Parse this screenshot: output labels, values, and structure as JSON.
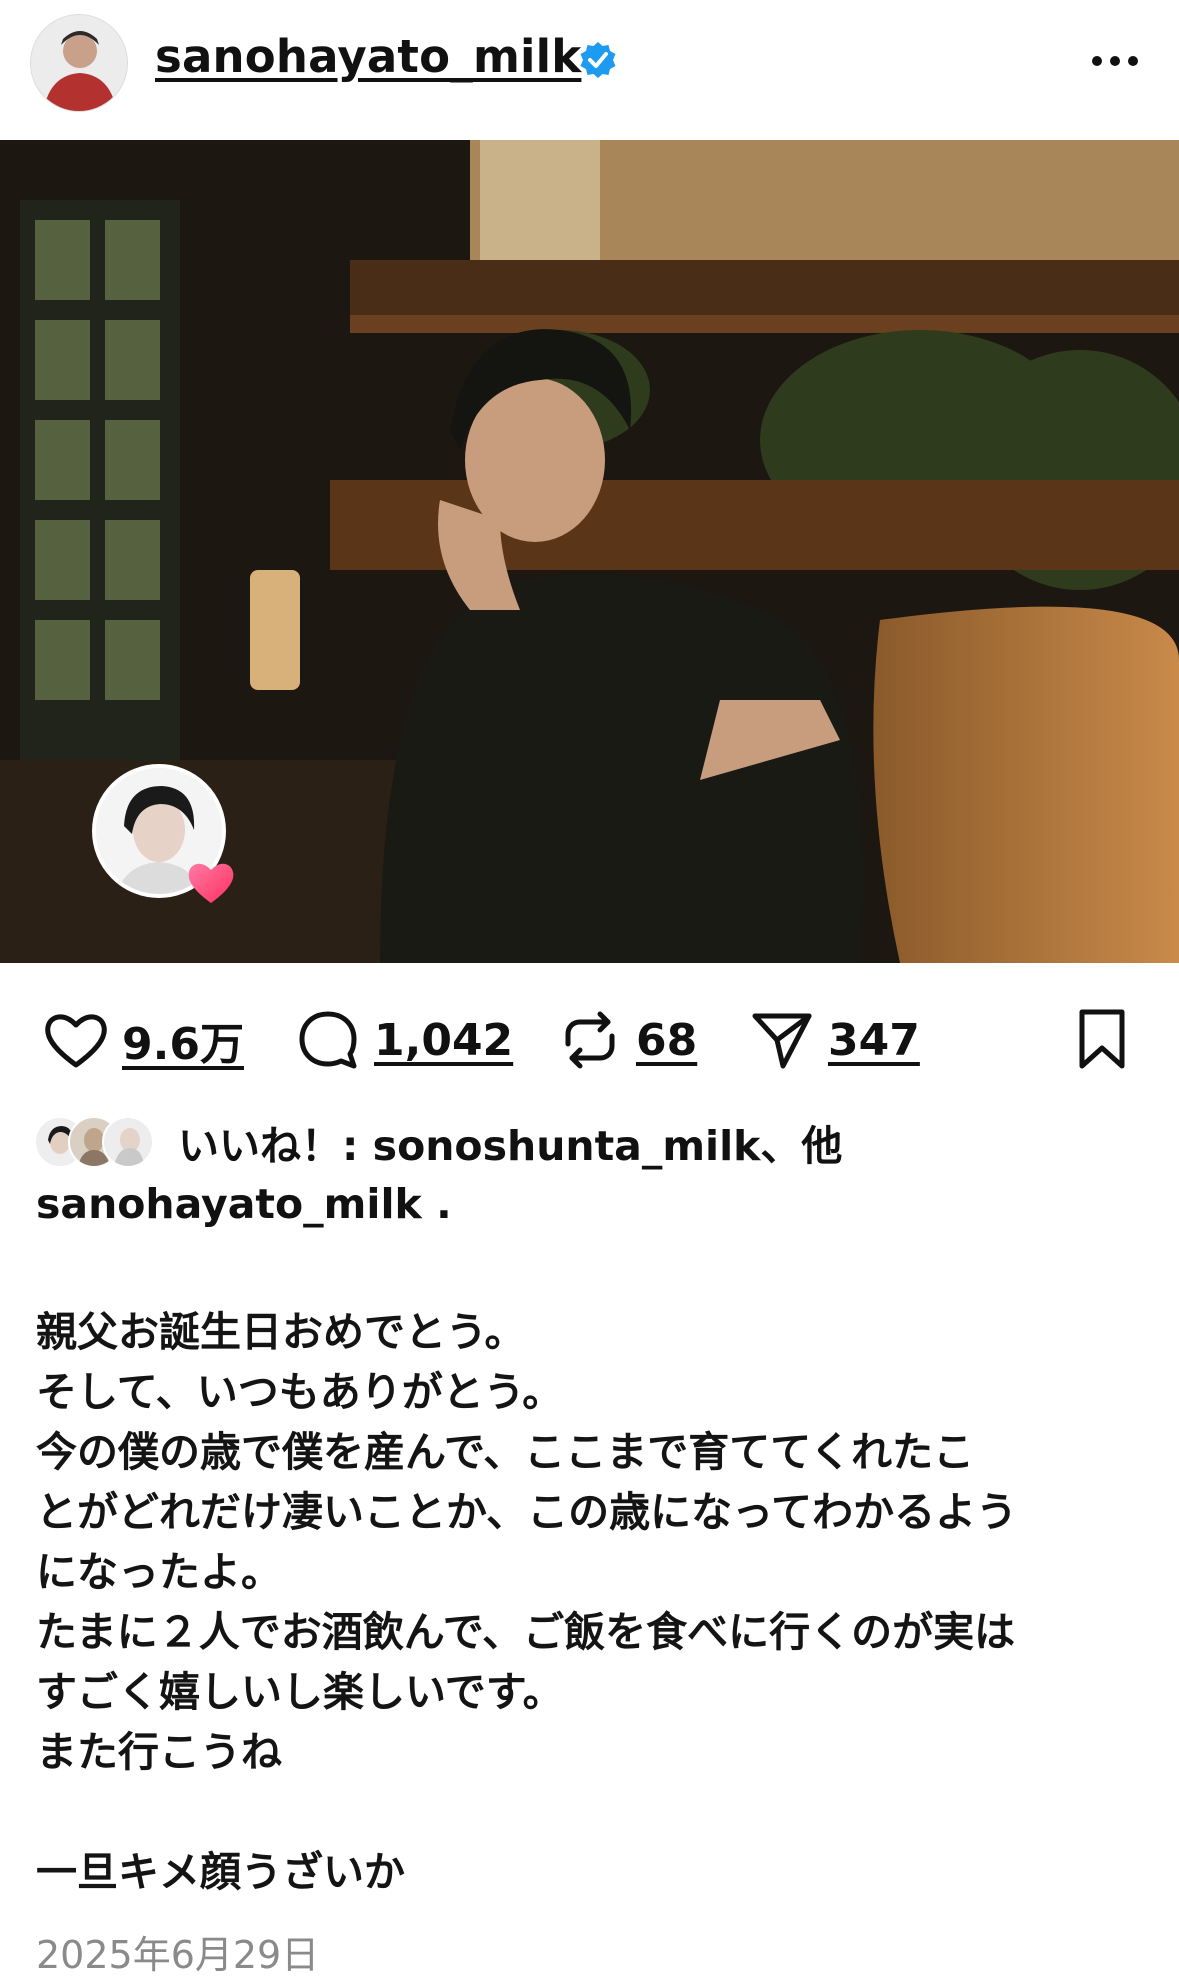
{
  "header": {
    "username": "sanohayato_milk",
    "more_icon": "more-icon",
    "verified_icon": "verified-badge-icon"
  },
  "post": {
    "tagged_icon": "heart-icon"
  },
  "actions": {
    "likes": "9.6万",
    "comments": "1,042",
    "reposts": "68",
    "shares": "347"
  },
  "liked_by": {
    "text": "いいね！: sonoshunta_milk、他"
  },
  "caption": {
    "username": "sanohayato_milk",
    "separator": ".",
    "text": "親父お誕生日おめでとう。\nそして、いつもありがとう。\n今の僕の歳で僕を産んで、ここまで育ててくれたこ\nとがどれだけ凄いことか、この歳になってわかるよう\nになったよ。\nたまに２人でお酒飲んで、ご飯を食べに行くのが実は\nすごく嬉しいし楽しいです。\nまた行こうね\n\n一旦キメ顔うざいか"
  },
  "date": "2025年6月29日",
  "colors": {
    "verified": "#1d9bf0",
    "heart": "#ff3b6b",
    "date": "#8a8a8a"
  }
}
